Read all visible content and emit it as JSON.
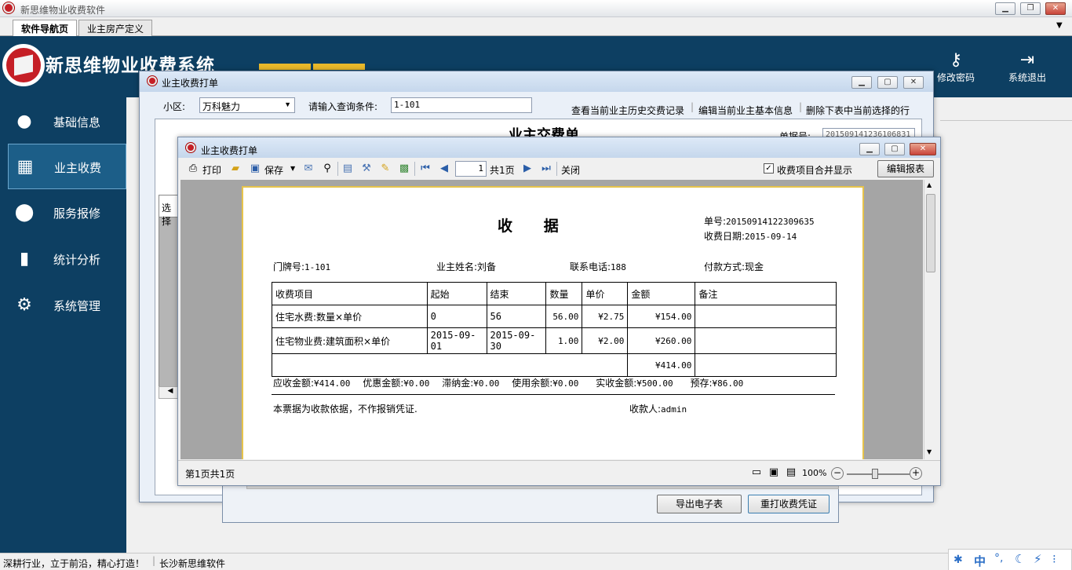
{
  "app": {
    "title": "新思维物业收费软件",
    "tabs": [
      {
        "label": "软件导航页"
      },
      {
        "label": "业主房产定义"
      }
    ],
    "brand": "新思维物业收费系统",
    "tools": [
      {
        "label": "修改密码",
        "icon": "key-icon"
      },
      {
        "label": "系统退出",
        "icon": "exit-icon"
      }
    ],
    "status_left": "深耕行业，立于前沿，精心打造！",
    "status_right": "长沙新思维软件",
    "tray": [
      "中",
      "°,"
    ]
  },
  "sidebar": {
    "items": [
      {
        "label": "基础信息",
        "icon": "user-icon"
      },
      {
        "label": "业主收费",
        "icon": "calendar-icon"
      },
      {
        "label": "服务报修",
        "icon": "location-pin-icon"
      },
      {
        "label": "统计分析",
        "icon": "bar-chart-icon"
      },
      {
        "label": "系统管理",
        "icon": "gear-icon"
      }
    ],
    "active_index": 1
  },
  "back_dialog": {
    "title": "业主收费打单",
    "area_label": "小区:",
    "area_value": "万科魅力",
    "query_label": "请输入查询条件:",
    "query_value": "1-101",
    "links": [
      "查看当前业主历史交费记录",
      "编辑当前业主基本信息",
      "删除下表中当前选择的行"
    ],
    "doc_title": "业主交费单",
    "doc_no_label": "单据号:",
    "doc_no_value": "201509141236106831",
    "grid_header": "选择",
    "buttons": [
      "导出电子表",
      "重打收费凭证"
    ]
  },
  "front_dialog": {
    "title": "业主收费打单",
    "toolbar": {
      "print": "打印",
      "save": "保存",
      "page_value": "1",
      "page_total": "共1页",
      "close": "关闭",
      "merge_label": "收费项目合并显示",
      "merge_checked": true,
      "edit_report": "编辑报表"
    },
    "footer": {
      "page_info": "第1页共1页",
      "zoom": "100%"
    }
  },
  "receipt": {
    "title": "收      据",
    "no_label": "单号:",
    "no_value": "20150914122309635",
    "date_label": "收费日期:",
    "date_value": "2015-09-14",
    "room_label": "门牌号:",
    "room_value": "1-101",
    "owner_label": "业主姓名:",
    "owner_value": "刘备",
    "phone_label": "联系电话:",
    "phone_value": "188",
    "pay_label": "付款方式:",
    "pay_value": "现金",
    "columns": [
      "收费项目",
      "起始",
      "结束",
      "数量",
      "单价",
      "金额",
      "备注"
    ],
    "rows": [
      [
        "住宅水费:数量×单价",
        "0",
        "56",
        "56.00",
        "¥2.75",
        "¥154.00",
        ""
      ],
      [
        "住宅物业费:建筑面积×单价",
        "2015-09-01",
        "2015-09-30",
        "1.00",
        "¥2.00",
        "¥260.00",
        ""
      ]
    ],
    "total": "¥414.00",
    "summary": [
      {
        "label": "应收金额:",
        "value": "¥414.00"
      },
      {
        "label": "优惠金额:",
        "value": "¥0.00"
      },
      {
        "label": "滞纳金:",
        "value": "¥0.00"
      },
      {
        "label": "使用余额:",
        "value": "¥0.00"
      },
      {
        "label": "实收金额:",
        "value": "¥500.00"
      },
      {
        "label": "预存:",
        "value": "¥86.00"
      }
    ],
    "note": "本票据为收款依据，不作报销凭证.",
    "cashier_label": "收款人:",
    "cashier_value": "admin"
  }
}
